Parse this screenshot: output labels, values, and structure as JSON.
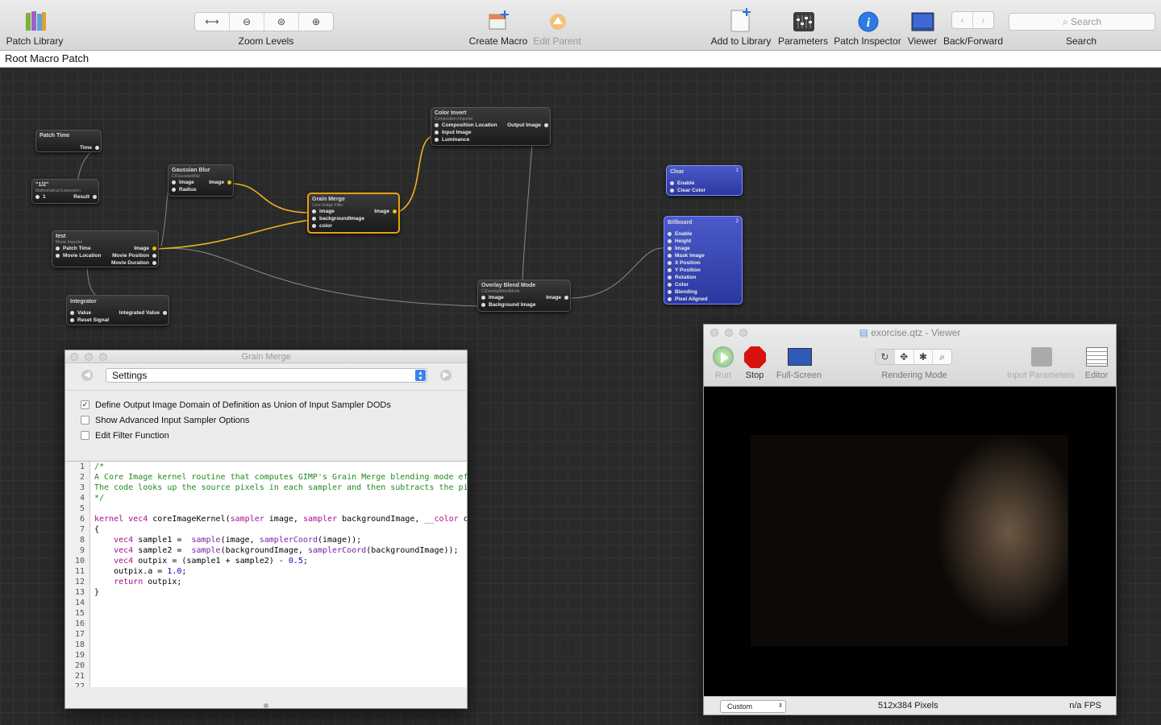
{
  "toolbar": {
    "patch_library": "Patch Library",
    "zoom_levels": "Zoom Levels",
    "create_macro": "Create Macro",
    "edit_parent": "Edit Parent",
    "add_to_library": "Add to Library",
    "parameters": "Parameters",
    "patch_inspector": "Patch Inspector",
    "viewer": "Viewer",
    "back_forward": "Back/Forward",
    "search_label": "Search",
    "search_placeholder": "Search"
  },
  "path_bar": {
    "title": "Root Macro Patch"
  },
  "patches": {
    "patch_time": {
      "title": "Patch Time",
      "out": "Time"
    },
    "math": {
      "title": "\"1/2\"",
      "subtitle": "Mathematical Expression",
      "in": "1",
      "out": "Result"
    },
    "gauss": {
      "title": "Gaussian Blur",
      "subtitle": "CIGaussianBlur",
      "in1": "Image",
      "in2": "Radius",
      "out": "Image"
    },
    "movie": {
      "title": "test",
      "subtitle": "Movie Importer",
      "in1": "Patch Time",
      "in2": "Movie Location",
      "out1": "Image",
      "out2": "Movie Position",
      "out3": "Movie Duration"
    },
    "integrator": {
      "title": "Integrator",
      "in1": "Value",
      "in2": "Reset Signal",
      "out": "Integrated Value"
    },
    "invert": {
      "title": "Color Invert",
      "subtitle": "Composition Importer",
      "in1": "Composition Location",
      "in2": "Input Image",
      "in3": "Luminance",
      "out": "Output Image"
    },
    "grain": {
      "title": "Grain Merge",
      "subtitle": "Core Image Filter",
      "in1": "image",
      "in2": "backgroundImage",
      "in3": "color",
      "out": "Image"
    },
    "overlay": {
      "title": "Overlay Blend Mode",
      "subtitle": "CIOverlayBlendMode",
      "in1": "Image",
      "in2": "Background Image",
      "out": "Image"
    },
    "clear": {
      "title": "Clear",
      "badge": "1",
      "in1": "Enable",
      "in2": "Clear Color"
    },
    "billboard": {
      "title": "Billboard",
      "badge": "2",
      "inputs": [
        "Enable",
        "Height",
        "Image",
        "Mask Image",
        "X Position",
        "Y Position",
        "Rotation",
        "Color",
        "Blending",
        "Pixel Aligned"
      ]
    }
  },
  "inspector": {
    "title": "Grain Merge",
    "popup": "Settings",
    "options": [
      "Define Output Image Domain of Definition as Union of Input Sampler DODs",
      "Show Advanced Input Sampler Options",
      "Edit Filter Function"
    ],
    "checked": [
      true,
      false,
      false
    ]
  },
  "viewer": {
    "title": "exorcise.qtz - Viewer",
    "run": "Run",
    "stop": "Stop",
    "fullscreen": "Full-Screen",
    "rendering_mode": "Rendering Mode",
    "input_parameters": "Input Parameters",
    "editor": "Editor",
    "size_popup": "Custom",
    "resolution": "512x384 Pixels",
    "fps": "n/a FPS"
  }
}
